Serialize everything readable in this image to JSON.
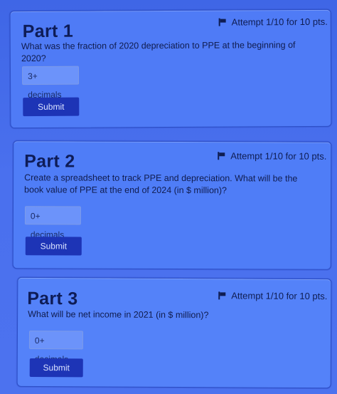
{
  "parts": [
    {
      "title": "Part 1",
      "attempt": "Attempt 1/10 for 10 pts.",
      "question": "What was the fraction of 2020 depreciation to PPE at the beginning of 2020?",
      "placeholder": "3+ decimals",
      "submit_label": "Submit"
    },
    {
      "title": "Part 2",
      "attempt": "Attempt 1/10 for 10 pts.",
      "question": "Create a spreadsheet to track PPE and depreciation. What will be the book value of PPE at the end of 2024 (in $ million)?",
      "placeholder": "0+ decimals",
      "submit_label": "Submit"
    },
    {
      "title": "Part 3",
      "attempt": "Attempt 1/10 for 10 pts.",
      "question": "What will be net income in 2021 (in $ million)?",
      "placeholder": "0+ decimals",
      "submit_label": "Submit"
    }
  ]
}
